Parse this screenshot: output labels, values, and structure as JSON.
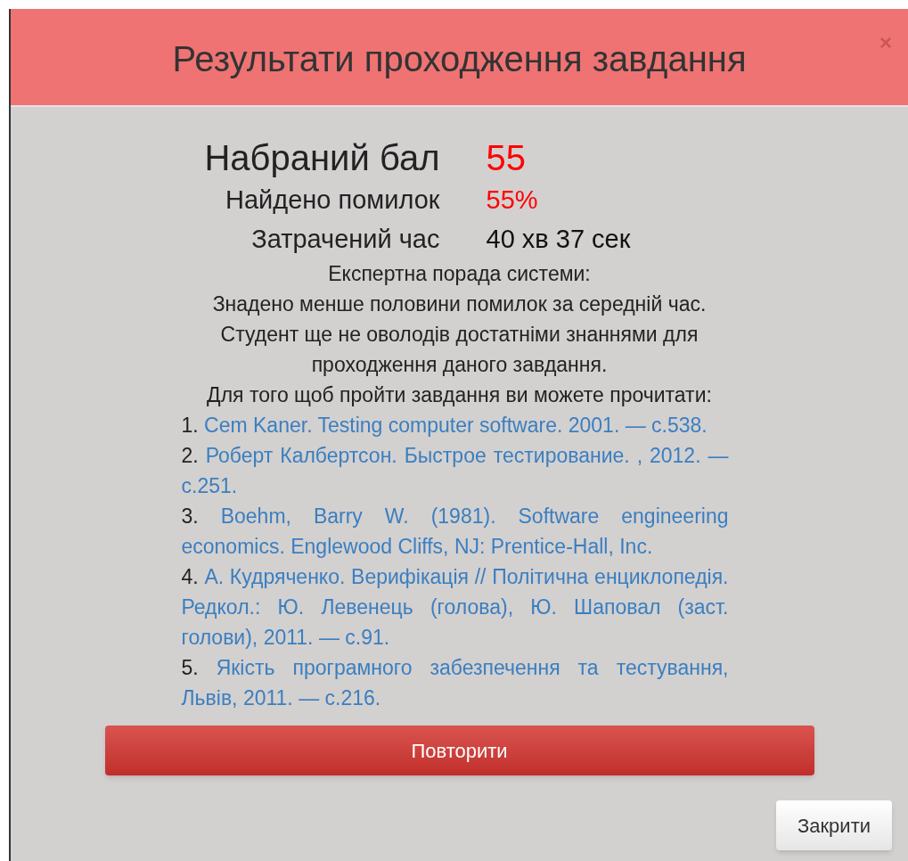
{
  "dialog": {
    "title": "Результати проходження завдання",
    "close_icon": "×"
  },
  "stats": [
    {
      "label": "Набраний бал",
      "value": "55",
      "kind": "score",
      "color": "#ff0000"
    },
    {
      "label": "Найдено помилок",
      "value": "55%",
      "kind": "normal",
      "color": "#ff0000"
    },
    {
      "label": "Затрачений час",
      "value": "40 хв 37 сек",
      "kind": "normal",
      "color": "#111111"
    }
  ],
  "advice": [
    "Експертна порада системи:",
    "Знадено менше половини помилок за середній час.",
    "Студент ще не оволодів достатніми знаннями для проходження даного завдання.",
    "Для того щоб пройти завдання ви можете прочитати:"
  ],
  "references": [
    {
      "number": "1.",
      "text": "Cem Kaner. Testing computer software. 2001. — c.538."
    },
    {
      "number": "2.",
      "text": "Роберт Калбертсон. Быстрое тестирование. , 2012. — c.251."
    },
    {
      "number": "3.",
      "text": "Boehm, Barry W. (1981). Software engineering economics. Englewood Cliffs, NJ: Prentice-Hall, Inc."
    },
    {
      "number": "4.",
      "text": "А. Кудряченко. Верифікація // Політична енциклопедія. Редкол.: Ю. Левенець (голова), Ю. Шаповал (заст. голови), 2011. — с.91."
    },
    {
      "number": "5.",
      "text": "Якість програмного забезпечення та тестування, Львів, 2011. — с.216."
    }
  ],
  "buttons": {
    "retry": "Повторити",
    "close": "Закрити"
  }
}
